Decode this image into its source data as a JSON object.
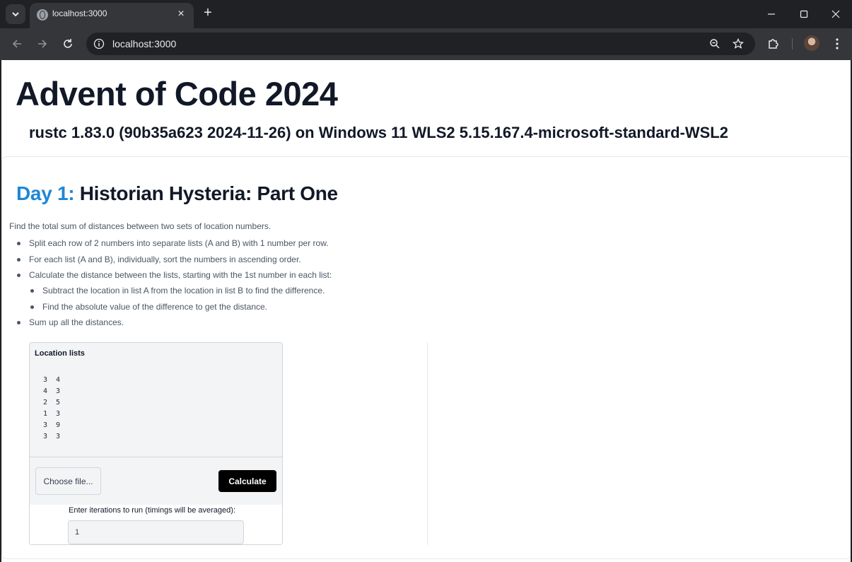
{
  "browser": {
    "tab_title": "localhost:3000",
    "url": "localhost:3000",
    "new_tab_label": "+",
    "close_tab_label": "×"
  },
  "page": {
    "title": "Advent of Code 2024",
    "subtitle": "rustc 1.83.0 (90b35a623 2024-11-26) on Windows 11 WLS2 5.15.167.4-microsoft-standard-WSL2"
  },
  "day": {
    "label": "Day 1:",
    "name": "Historian Hysteria: Part One",
    "accent_color": "#1f87d6",
    "intro": "Find the total sum of distances between two sets of location numbers.",
    "steps": [
      "Split each row of 2 numbers into separate lists (A and B) with 1 number per row.",
      "For each list (A and B), individually, sort the numbers in ascending order.",
      "Calculate the distance between the lists, starting with the 1st number in each list:"
    ],
    "substeps": [
      "Subtract the location in list A from the location in list B to find the difference.",
      "Find the absolute value of the difference to get the distance."
    ],
    "final_step": "Sum up all the distances."
  },
  "form": {
    "location_label": "Location lists",
    "location_value": "3  4\n4  3\n2  5\n1  3\n3  9\n3  3",
    "file_button": "Choose file...",
    "calculate_button": "Calculate",
    "iterations_label": "Enter iterations to run (timings will be averaged):",
    "iterations_value": "1"
  }
}
